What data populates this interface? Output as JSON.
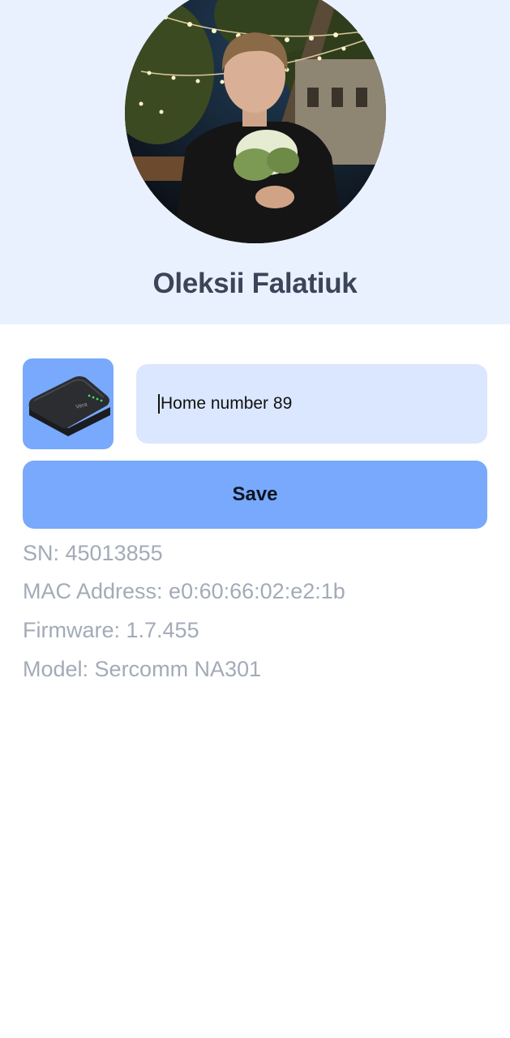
{
  "profile": {
    "name": "Oleksii Falatiuk",
    "avatar_icon": "user-photo"
  },
  "device": {
    "thumbnail_icon": "router-device-icon",
    "name_input_value": "Home number 89",
    "save_label": "Save",
    "info": {
      "sn": "SN: 45013855",
      "mac": "MAC Address: e0:60:66:02:e2:1b",
      "firmware": "Firmware: 1.7.455",
      "model": "Model: Sercomm NA301"
    }
  },
  "colors": {
    "header_bg": "#eaf1fe",
    "accent": "#78a9fc",
    "input_bg": "#dbe7fe",
    "info_text": "#a3abb8",
    "name_text": "#3a4558"
  }
}
